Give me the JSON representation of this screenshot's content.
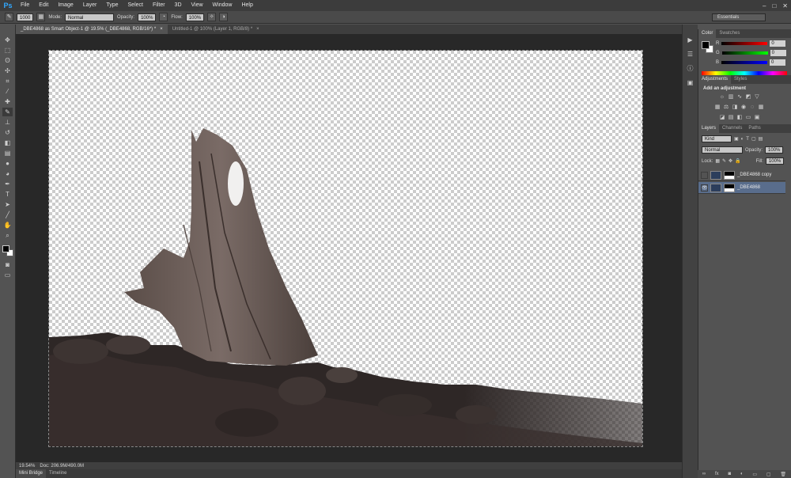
{
  "app": {
    "logo": "Ps"
  },
  "menu": [
    "File",
    "Edit",
    "Image",
    "Layer",
    "Type",
    "Select",
    "Filter",
    "3D",
    "View",
    "Window",
    "Help"
  ],
  "window_controls": {
    "minimize": "–",
    "restore": "□",
    "close": "✕"
  },
  "options": {
    "brush_size": "1000",
    "mode_label": "Mode:",
    "mode_value": "Normal",
    "opacity_label": "Opacity:",
    "opacity_value": "100%",
    "flow_label": "Flow:",
    "flow_value": "100%",
    "workspace": "Essentials"
  },
  "tabs": [
    {
      "label": "_DBE4868 as Smart Object-1 @ 19.5% (_DBE4868, RGB/16*) *",
      "close": "×"
    },
    {
      "label": "Untitled-1 @ 100% (Layer 1, RGB/8) *",
      "close": "×"
    }
  ],
  "status": {
    "zoom": "19.54%",
    "doc": "Doc: 206.9M/490.0M"
  },
  "bottom_tabs": [
    "Mini Bridge",
    "Timeline"
  ],
  "color_panel": {
    "tabs": [
      "Color",
      "Swatches"
    ],
    "r": "0",
    "g": "0",
    "b": "0",
    "r_label": "R",
    "g_label": "G",
    "b_label": "B"
  },
  "adjustments_panel": {
    "tabs": [
      "Adjustments",
      "Styles"
    ],
    "title": "Add an adjustment"
  },
  "layers_panel": {
    "tabs": [
      "Layers",
      "Channels",
      "Paths"
    ],
    "kind": "Kind",
    "blend": "Normal",
    "opacity_label": "Opacity:",
    "opacity_value": "100%",
    "lock_label": "Lock:",
    "fill_label": "Fill:",
    "fill_value": "100%",
    "layers": [
      {
        "name": "_DBE4868 copy",
        "visible": false,
        "selected": false
      },
      {
        "name": "_DBE4868",
        "visible": true,
        "selected": true
      }
    ]
  },
  "colors": {
    "accent": "#31a8ff",
    "selection": "#596d8c"
  }
}
